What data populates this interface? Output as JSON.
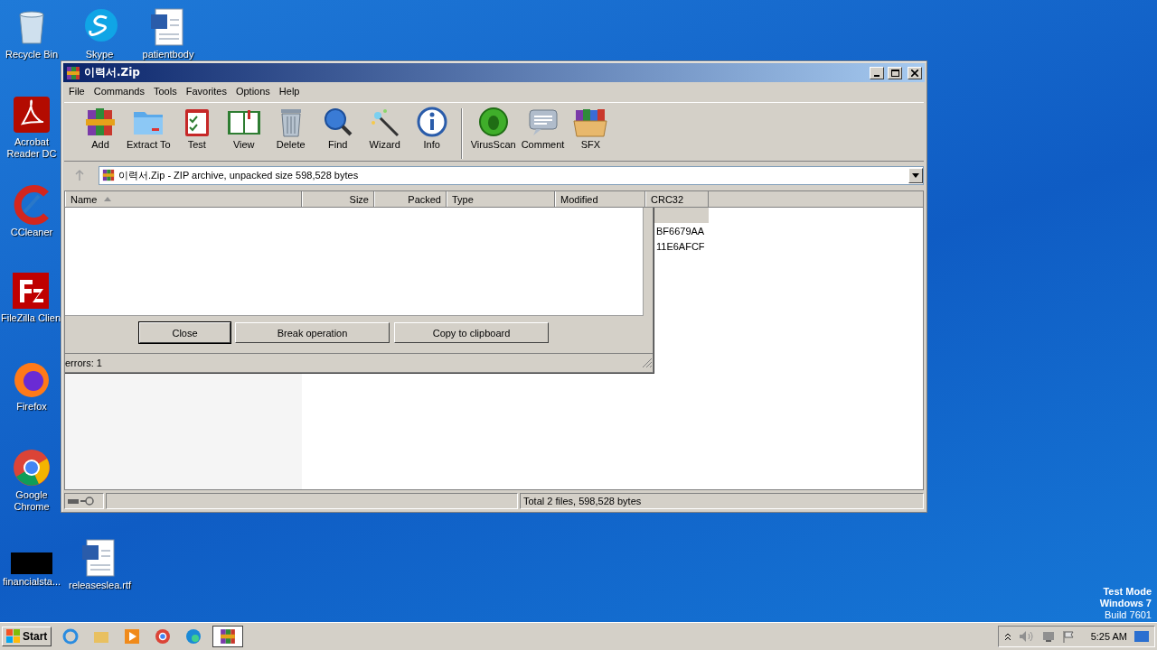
{
  "desktop_icons": [
    {
      "label": "Recycle Bin"
    },
    {
      "label": "Skype"
    },
    {
      "label": "patientbody"
    },
    {
      "label": "Acrobat Reader DC"
    },
    {
      "label": "CCleaner"
    },
    {
      "label": "FileZilla Clien"
    },
    {
      "label": "Firefox"
    },
    {
      "label": "Google Chrome"
    },
    {
      "label": "financialsta..."
    },
    {
      "label": "releaseslea.rtf"
    }
  ],
  "window": {
    "title": "이력서.Zip",
    "menu": [
      "File",
      "Commands",
      "Tools",
      "Favorites",
      "Options",
      "Help"
    ],
    "toolbar": [
      "Add",
      "Extract To",
      "Test",
      "View",
      "Delete",
      "Find",
      "Wizard",
      "Info",
      "VirusScan",
      "Comment",
      "SFX"
    ],
    "address": "이력서.Zip - ZIP archive, unpacked size 598,528 bytes",
    "columns": [
      "Name",
      "Size",
      "Packed",
      "Type",
      "Modified",
      "CRC32"
    ],
    "crc_values": [
      "BF6679AA",
      "11E6AFCF"
    ],
    "status": "Total 2 files, 598,528 bytes"
  },
  "dialog": {
    "buttons": [
      "Close",
      "Break operation",
      "Copy to clipboard"
    ],
    "status": "errors: 1"
  },
  "system_info": [
    "Test Mode",
    "Windows 7",
    "Build 7601"
  ],
  "taskbar": {
    "start": "Start",
    "clock": "5:25 AM"
  }
}
